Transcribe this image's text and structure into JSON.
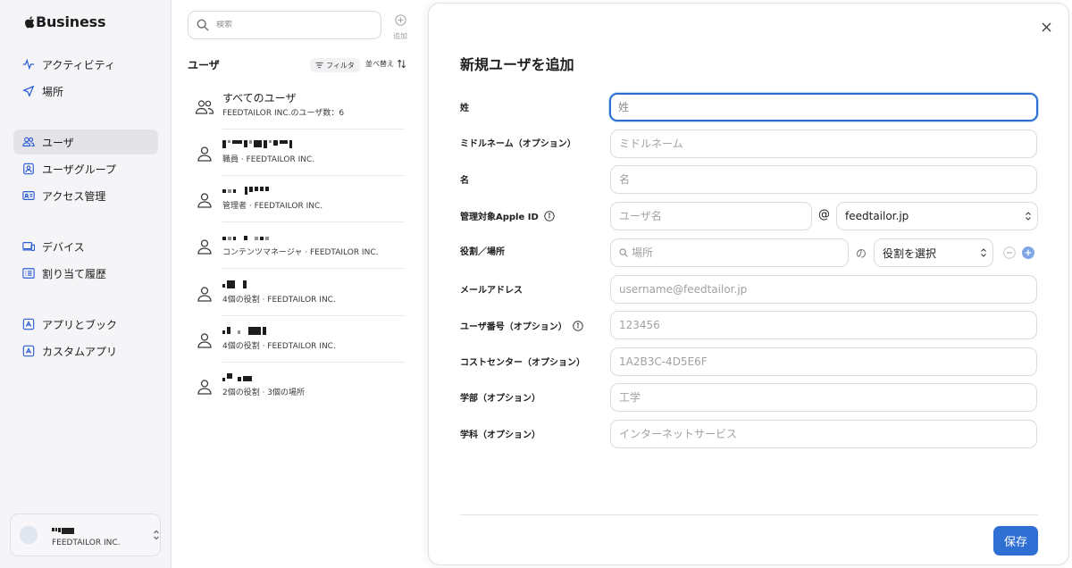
{
  "brand": {
    "logo": "apple-logo",
    "name": "Business"
  },
  "sidebar": {
    "items": [
      {
        "label": "アクティビティ",
        "icon": "activity-icon"
      },
      {
        "label": "場所",
        "icon": "location-arrow-icon"
      },
      {
        "label": "ユーザ",
        "icon": "users-icon",
        "active": true
      },
      {
        "label": "ユーザグループ",
        "icon": "user-group-icon"
      },
      {
        "label": "アクセス管理",
        "icon": "id-card-icon"
      },
      {
        "label": "デバイス",
        "icon": "devices-icon"
      },
      {
        "label": "割り当て履歴",
        "icon": "history-list-icon"
      },
      {
        "label": "アプリとブック",
        "icon": "app-store-icon"
      },
      {
        "label": "カスタムアプリ",
        "icon": "custom-app-icon"
      }
    ],
    "account": {
      "org": "FEEDTAILOR INC."
    }
  },
  "list": {
    "search_placeholder": "検索",
    "add_label": "追加",
    "heading": "ユーザ",
    "filter_label": "フィルタ",
    "sort_label": "並べ替え",
    "rows": [
      {
        "name": "すべてのユーザ",
        "sub": "FEEDTAILOR INC.のユーザ数：6"
      },
      {
        "sub": "職員 · FEEDTAILOR INC."
      },
      {
        "sub": "管理者 · FEEDTAILOR INC."
      },
      {
        "sub": "コンテンツマネージャ · FEEDTAILOR INC."
      },
      {
        "sub": "4個の役割 · FEEDTAILOR INC."
      },
      {
        "sub": "4個の役割 · FEEDTAILOR INC."
      },
      {
        "sub": "2個の役割 · 3個の場所"
      }
    ]
  },
  "panel": {
    "title": "新規ユーザを追加",
    "fields": {
      "last_name": {
        "label": "姓",
        "placeholder": "姓"
      },
      "middle_name": {
        "label": "ミドルネーム（オプション）",
        "placeholder": "ミドルネーム"
      },
      "first_name": {
        "label": "名",
        "placeholder": "名"
      },
      "apple_id": {
        "label": "管理対象Apple ID",
        "placeholder": "ユーザ名",
        "at": "@",
        "domain": "feedtailor.jp"
      },
      "role": {
        "label": "役割／場所",
        "location_placeholder": "場所",
        "connector": "の",
        "role_select": "役割を選択"
      },
      "email": {
        "label": "メールアドレス",
        "placeholder": "username@feedtailor.jp"
      },
      "user_number": {
        "label": "ユーザ番号（オプション）",
        "placeholder": "123456"
      },
      "cost_center": {
        "label": "コストセンター（オプション）",
        "placeholder": "1A2B3C-4D5E6F"
      },
      "faculty": {
        "label": "学部（オプション）",
        "placeholder": "工学"
      },
      "department": {
        "label": "学科（オプション）",
        "placeholder": "インターネットサービス"
      }
    },
    "save_label": "保存"
  },
  "colors": {
    "accent": "#2f6fd3",
    "focus_ring": "#2a6fd1",
    "sidebar_active": "#e3e3e8"
  }
}
